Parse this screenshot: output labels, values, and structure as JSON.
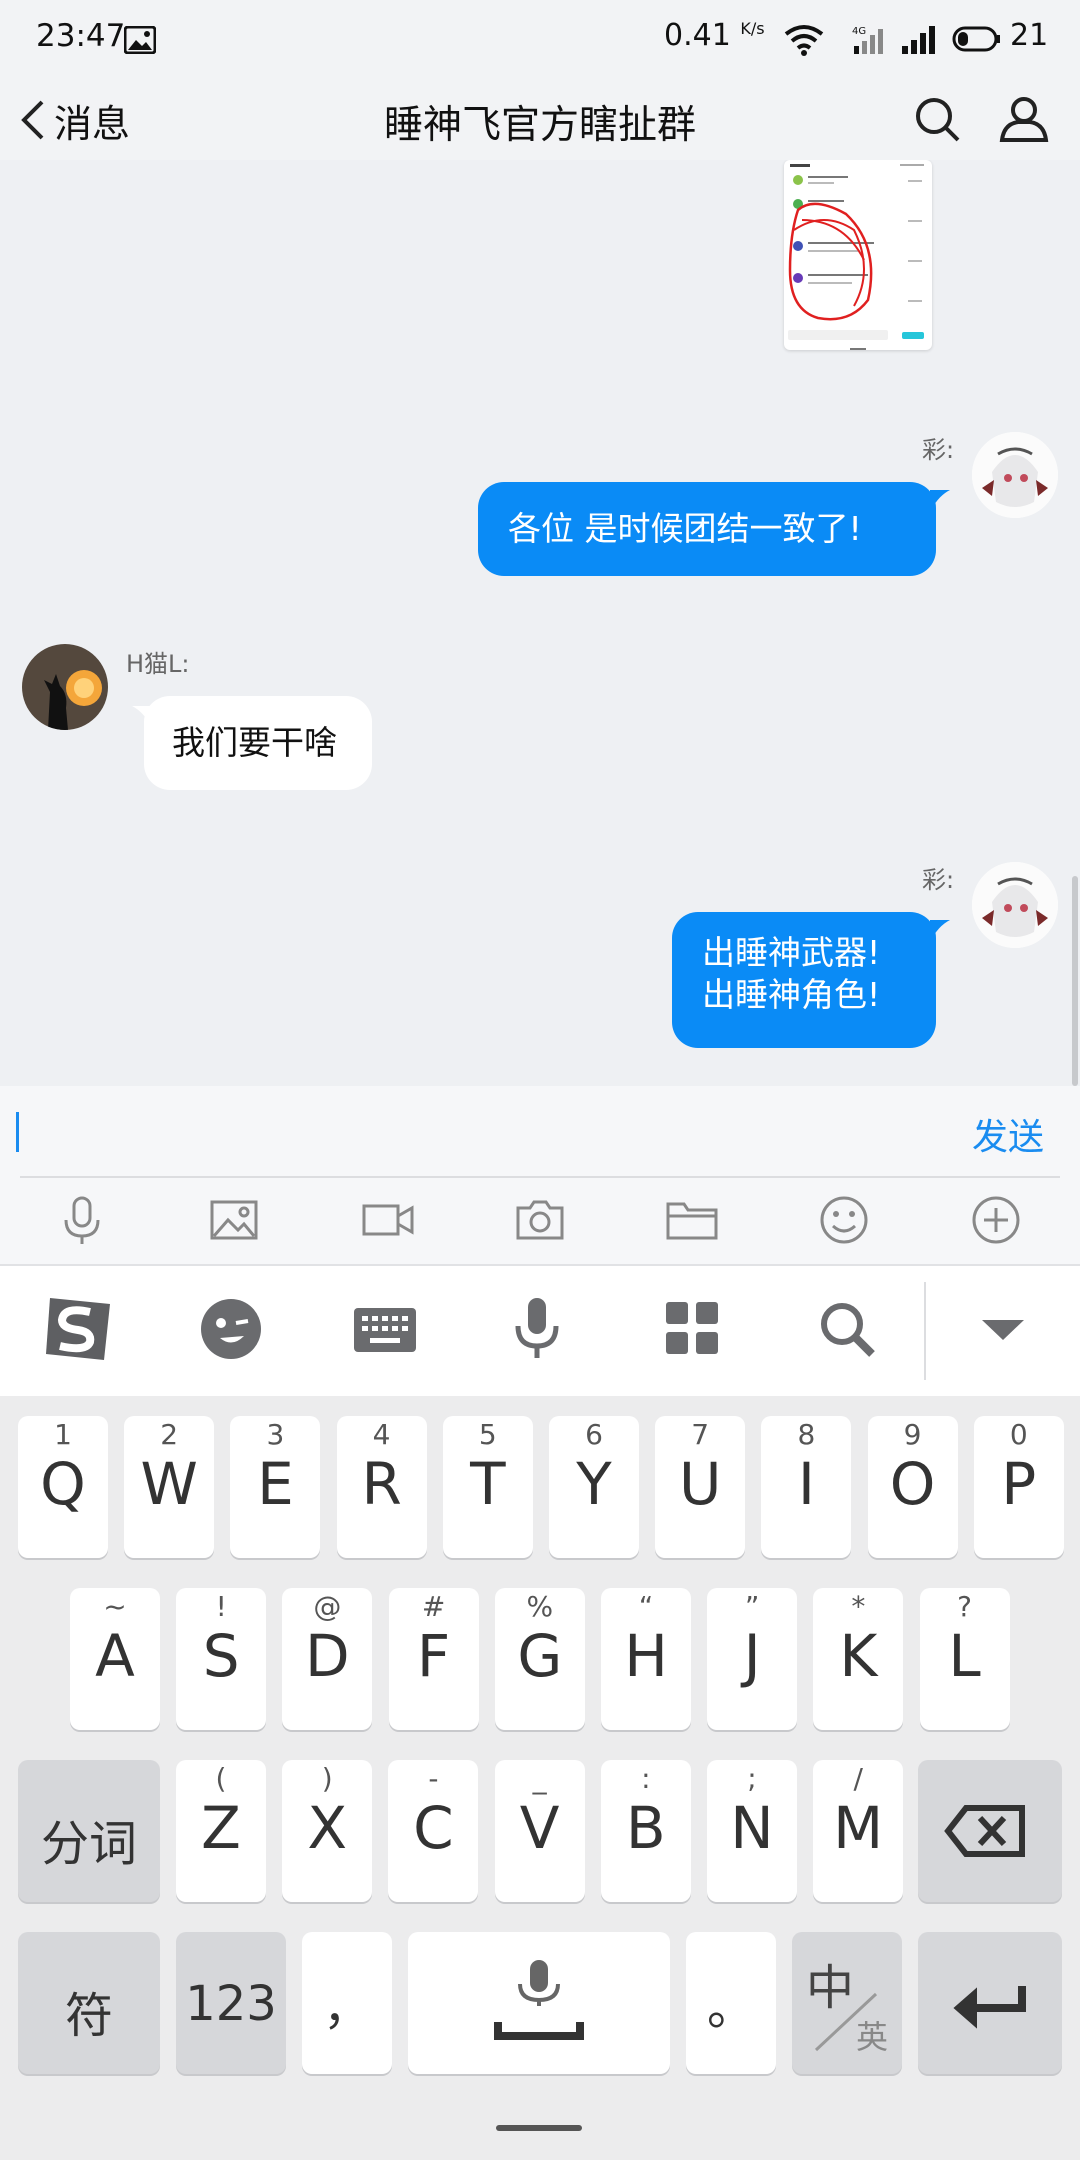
{
  "status": {
    "time": "23:47",
    "speed": "0.41",
    "speed_unit": "K/s",
    "battery": "21"
  },
  "header": {
    "back_label": "消息",
    "title": "睡神飞官方瞎扯群"
  },
  "messages": [
    {
      "sender": "彩:",
      "text": "各位  是时候团结一致了!"
    },
    {
      "sender": "H猫L:",
      "text": "我们要干啥"
    },
    {
      "sender": "彩:",
      "line1": "出睡神武器!",
      "line2": "出睡神角色!"
    }
  ],
  "input": {
    "value": "",
    "send_label": "发送"
  },
  "toolbar_icons": [
    "mic-icon",
    "image-icon",
    "video-icon",
    "camera-icon",
    "folder-icon",
    "emoji-icon",
    "plus-icon"
  ],
  "ime_bar_icons": [
    "sogou-logo",
    "emoji-icon",
    "keyboard-icon",
    "mic-icon",
    "apps-icon",
    "search-icon",
    "collapse-icon"
  ],
  "keyboard": {
    "row1": [
      {
        "h": "1",
        "k": "Q"
      },
      {
        "h": "2",
        "k": "W"
      },
      {
        "h": "3",
        "k": "E"
      },
      {
        "h": "4",
        "k": "R"
      },
      {
        "h": "5",
        "k": "T"
      },
      {
        "h": "6",
        "k": "Y"
      },
      {
        "h": "7",
        "k": "U"
      },
      {
        "h": "8",
        "k": "I"
      },
      {
        "h": "9",
        "k": "O"
      },
      {
        "h": "0",
        "k": "P"
      }
    ],
    "row2": [
      {
        "h": "~",
        "k": "A"
      },
      {
        "h": "!",
        "k": "S"
      },
      {
        "h": "@",
        "k": "D"
      },
      {
        "h": "#",
        "k": "F"
      },
      {
        "h": "%",
        "k": "G"
      },
      {
        "h": "“",
        "k": "H"
      },
      {
        "h": "”",
        "k": "J"
      },
      {
        "h": "*",
        "k": "K"
      },
      {
        "h": "?",
        "k": "L"
      }
    ],
    "row3": [
      {
        "h": "(",
        "k": "Z"
      },
      {
        "h": ")",
        "k": "X"
      },
      {
        "h": "-",
        "k": "C"
      },
      {
        "h": "_",
        "k": "V"
      },
      {
        "h": ":",
        "k": "B"
      },
      {
        "h": ";",
        "k": "N"
      },
      {
        "h": "/",
        "k": "M"
      }
    ],
    "split_label": "分词",
    "sym_label": "符",
    "num_label": "123",
    "comma": "，",
    "period": "。",
    "zh": "中",
    "en": "英"
  }
}
